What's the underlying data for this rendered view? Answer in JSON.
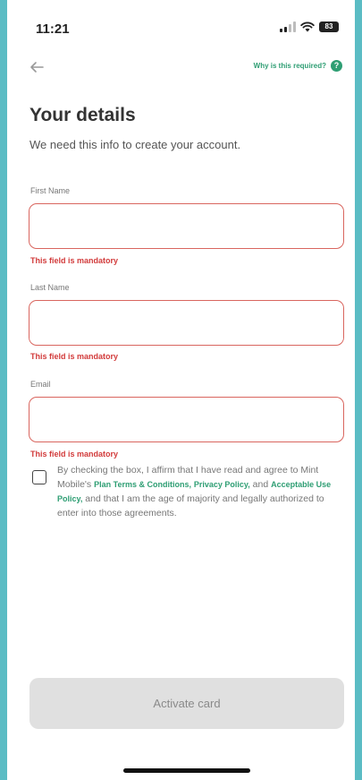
{
  "status_bar": {
    "time": "11:21",
    "battery": "83"
  },
  "nav": {
    "help_link": "Why is this required?",
    "help_icon": "?"
  },
  "page": {
    "title": "Your details",
    "subtitle": "We need this info to create your account."
  },
  "form": {
    "first_name": {
      "label": "First Name",
      "value": "",
      "error": "This field is mandatory"
    },
    "last_name": {
      "label": "Last Name",
      "value": "",
      "error": "This field is mandatory"
    },
    "email": {
      "label": "Email",
      "value": "",
      "error": "This field is mandatory"
    }
  },
  "consent": {
    "checked": false,
    "text_1": "By checking the box, I affirm that I have read and agree to Mint Mobile's ",
    "link_terms": "Plan Terms & Conditions,",
    "text_2": " ",
    "link_privacy": "Privacy Policy,",
    "text_3": " and ",
    "link_aup": "Acceptable Use Policy,",
    "text_4": " and that I am the age of majority and legally authorized to enter into those agreements."
  },
  "actions": {
    "activate_label": "Activate card"
  },
  "colors": {
    "background": "#5bbcc4",
    "accent": "#2e9e73",
    "error": "#d23b3b",
    "error_border": "#d9665f"
  }
}
